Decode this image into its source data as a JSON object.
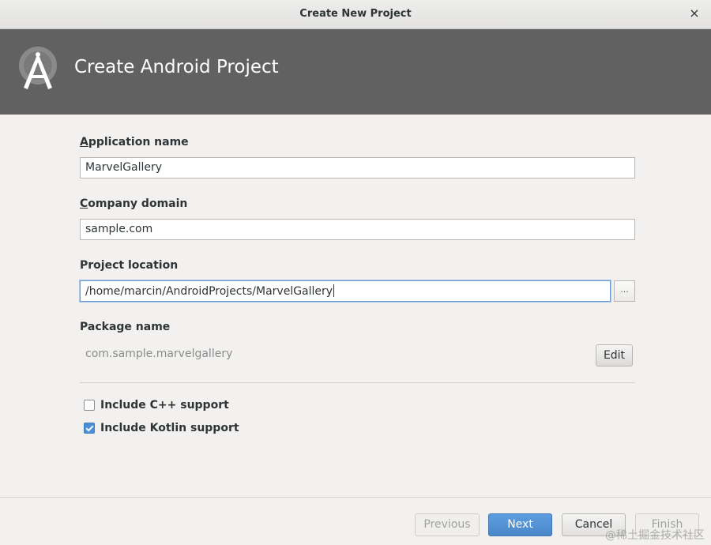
{
  "window": {
    "title": "Create New Project",
    "close_glyph": "×"
  },
  "banner": {
    "heading": "Create Android Project",
    "logo_icon": "android-studio-logo-icon"
  },
  "form": {
    "app_name": {
      "label_mnemonic": "A",
      "label_rest": "pplication name",
      "value": "MarvelGallery"
    },
    "company_domain": {
      "label_mnemonic": "C",
      "label_rest": "ompany domain",
      "value": "sample.com"
    },
    "project_location": {
      "label": "Project location",
      "value": "/home/marcin/AndroidProjects/MarvelGallery",
      "browse_label": "..."
    },
    "package_name": {
      "label": "Package name",
      "value": "com.sample.marvelgallery",
      "edit_label": "Edit"
    },
    "options": [
      {
        "label": "Include C++ support",
        "checked": false
      },
      {
        "label": "Include Kotlin support",
        "checked": true
      }
    ]
  },
  "footer": {
    "previous_label": "Previous",
    "next_label": "Next",
    "cancel_label": "Cancel",
    "finish_label": "Finish"
  },
  "watermark": "@稀土掘金技术社区",
  "colors": {
    "banner_bg": "#616161",
    "accent": "#4a90d9",
    "dialog_bg": "#f2f1f0"
  }
}
